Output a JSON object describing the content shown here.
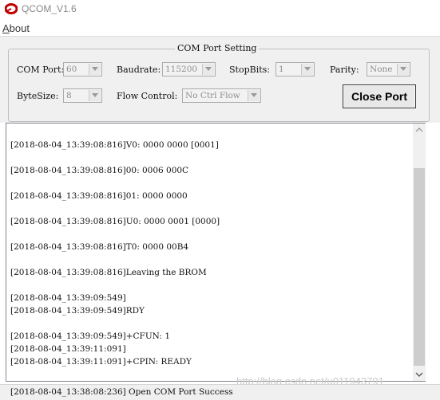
{
  "window": {
    "title": "QCOM_V1.6",
    "icon": "qcom-logo-icon"
  },
  "menu": {
    "about_prefix": "A",
    "about_rest": "bout"
  },
  "settings": {
    "group_title": "COM Port Setting",
    "com_port_label": "COM Port:",
    "com_port_value": "60",
    "baudrate_label": "Baudrate:",
    "baudrate_value": "115200",
    "stopbits_label": "StopBits:",
    "stopbits_value": "1",
    "parity_label": "Parity:",
    "parity_value": "None",
    "bytesize_label": "ByteSize:",
    "bytesize_value": "8",
    "flow_control_label": "Flow Control:",
    "flow_control_value": "No Ctrl Flow",
    "close_port_button": "Close Port"
  },
  "log": {
    "lines": [
      "[2018-08-04_13:39:08:816]V0: 0000 0000 [0001]",
      "[2018-08-04_13:39:08:816]00: 0006 000C",
      "[2018-08-04_13:39:08:816]01: 0000 0000",
      "[2018-08-04_13:39:08:816]U0: 0000 0001 [0000]",
      "[2018-08-04_13:39:08:816]T0: 0000 00B4",
      "[2018-08-04_13:39:08:816]Leaving the BROM",
      "[2018-08-04_13:39:09:549]",
      "[2018-08-04_13:39:09:549]RDY",
      "[2018-08-04_13:39:09:549]+CFUN: 1",
      "[2018-08-04_13:39:11:091]",
      "[2018-08-04_13:39:11:091]+CPIN: READY"
    ]
  },
  "status": {
    "text": "[2018-08-04_13:38:08:236] Open COM Port Success"
  },
  "watermark": "http://blog.csdn.net/u011943791"
}
